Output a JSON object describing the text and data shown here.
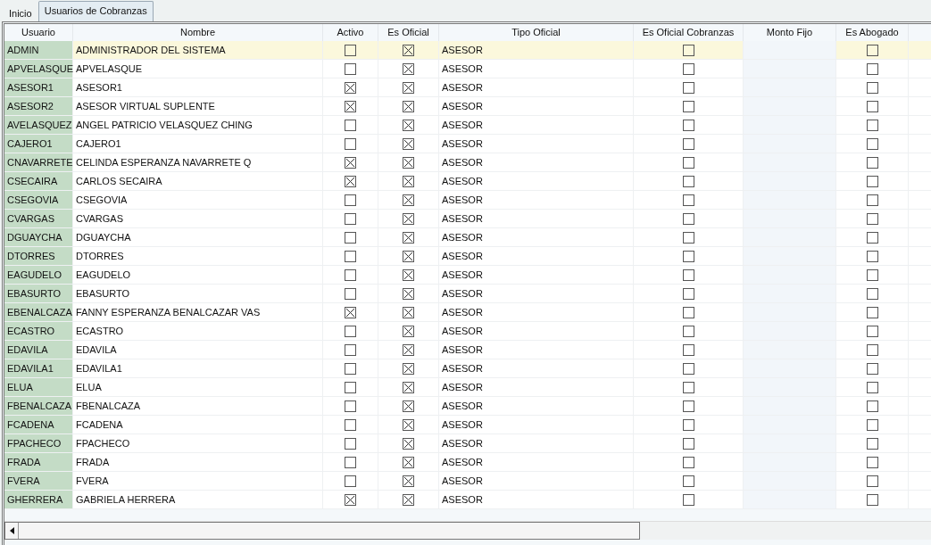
{
  "tabs": [
    {
      "label": "Inicio",
      "selected": false
    },
    {
      "label": "Usuarios de Cobranzas",
      "selected": true
    }
  ],
  "table": {
    "columns": [
      "Usuario",
      "Nombre",
      "Activo",
      "Es Oficial",
      "Tipo Oficial",
      "Es Oficial Cobranzas",
      "Monto Fijo",
      "Es Abogado"
    ],
    "rows": [
      {
        "usuario": "ADMIN",
        "nombre": "ADMINISTRADOR DEL SISTEMA",
        "activo": false,
        "es_oficial": true,
        "tipo_oficial": "ASESOR",
        "es_oficial_cobranzas": false,
        "es_abogado": false,
        "selected": true
      },
      {
        "usuario": "APVELASQUE",
        "nombre": "APVELASQUE",
        "activo": false,
        "es_oficial": true,
        "tipo_oficial": "ASESOR",
        "es_oficial_cobranzas": false,
        "es_abogado": false,
        "selected": false
      },
      {
        "usuario": "ASESOR1",
        "nombre": "ASESOR1",
        "activo": true,
        "es_oficial": true,
        "tipo_oficial": "ASESOR",
        "es_oficial_cobranzas": false,
        "es_abogado": false,
        "selected": false
      },
      {
        "usuario": "ASESOR2",
        "nombre": "ASESOR VIRTUAL SUPLENTE",
        "activo": true,
        "es_oficial": true,
        "tipo_oficial": "ASESOR",
        "es_oficial_cobranzas": false,
        "es_abogado": false,
        "selected": false
      },
      {
        "usuario": "AVELASQUEZ",
        "nombre": "ANGEL PATRICIO VELASQUEZ CHING",
        "activo": false,
        "es_oficial": true,
        "tipo_oficial": "ASESOR",
        "es_oficial_cobranzas": false,
        "es_abogado": false,
        "selected": false
      },
      {
        "usuario": "CAJERO1",
        "nombre": "CAJERO1",
        "activo": false,
        "es_oficial": true,
        "tipo_oficial": "ASESOR",
        "es_oficial_cobranzas": false,
        "es_abogado": false,
        "selected": false
      },
      {
        "usuario": "CNAVARRETE",
        "nombre": "CELINDA ESPERANZA NAVARRETE Q",
        "activo": true,
        "es_oficial": true,
        "tipo_oficial": "ASESOR",
        "es_oficial_cobranzas": false,
        "es_abogado": false,
        "selected": false
      },
      {
        "usuario": "CSECAIRA",
        "nombre": "CARLOS SECAIRA",
        "activo": true,
        "es_oficial": true,
        "tipo_oficial": "ASESOR",
        "es_oficial_cobranzas": false,
        "es_abogado": false,
        "selected": false
      },
      {
        "usuario": "CSEGOVIA",
        "nombre": "CSEGOVIA",
        "activo": false,
        "es_oficial": true,
        "tipo_oficial": "ASESOR",
        "es_oficial_cobranzas": false,
        "es_abogado": false,
        "selected": false
      },
      {
        "usuario": "CVARGAS",
        "nombre": "CVARGAS",
        "activo": false,
        "es_oficial": true,
        "tipo_oficial": "ASESOR",
        "es_oficial_cobranzas": false,
        "es_abogado": false,
        "selected": false
      },
      {
        "usuario": "DGUAYCHA",
        "nombre": "DGUAYCHA",
        "activo": false,
        "es_oficial": true,
        "tipo_oficial": "ASESOR",
        "es_oficial_cobranzas": false,
        "es_abogado": false,
        "selected": false
      },
      {
        "usuario": "DTORRES",
        "nombre": "DTORRES",
        "activo": false,
        "es_oficial": true,
        "tipo_oficial": "ASESOR",
        "es_oficial_cobranzas": false,
        "es_abogado": false,
        "selected": false
      },
      {
        "usuario": "EAGUDELO",
        "nombre": "EAGUDELO",
        "activo": false,
        "es_oficial": true,
        "tipo_oficial": "ASESOR",
        "es_oficial_cobranzas": false,
        "es_abogado": false,
        "selected": false
      },
      {
        "usuario": "EBASURTO",
        "nombre": "EBASURTO",
        "activo": false,
        "es_oficial": true,
        "tipo_oficial": "ASESOR",
        "es_oficial_cobranzas": false,
        "es_abogado": false,
        "selected": false
      },
      {
        "usuario": "EBENALCAZA",
        "nombre": "FANNY ESPERANZA BENALCAZAR VAS",
        "activo": true,
        "es_oficial": true,
        "tipo_oficial": "ASESOR",
        "es_oficial_cobranzas": false,
        "es_abogado": false,
        "selected": false
      },
      {
        "usuario": "ECASTRO",
        "nombre": "ECASTRO",
        "activo": false,
        "es_oficial": true,
        "tipo_oficial": "ASESOR",
        "es_oficial_cobranzas": false,
        "es_abogado": false,
        "selected": false
      },
      {
        "usuario": "EDAVILA",
        "nombre": "EDAVILA",
        "activo": false,
        "es_oficial": true,
        "tipo_oficial": "ASESOR",
        "es_oficial_cobranzas": false,
        "es_abogado": false,
        "selected": false
      },
      {
        "usuario": "EDAVILA1",
        "nombre": "EDAVILA1",
        "activo": false,
        "es_oficial": true,
        "tipo_oficial": "ASESOR",
        "es_oficial_cobranzas": false,
        "es_abogado": false,
        "selected": false
      },
      {
        "usuario": "ELUA",
        "nombre": "ELUA",
        "activo": false,
        "es_oficial": true,
        "tipo_oficial": "ASESOR",
        "es_oficial_cobranzas": false,
        "es_abogado": false,
        "selected": false
      },
      {
        "usuario": "FBENALCAZA",
        "nombre": "FBENALCAZA",
        "activo": false,
        "es_oficial": true,
        "tipo_oficial": "ASESOR",
        "es_oficial_cobranzas": false,
        "es_abogado": false,
        "selected": false
      },
      {
        "usuario": "FCADENA",
        "nombre": "FCADENA",
        "activo": false,
        "es_oficial": true,
        "tipo_oficial": "ASESOR",
        "es_oficial_cobranzas": false,
        "es_abogado": false,
        "selected": false
      },
      {
        "usuario": "FPACHECO",
        "nombre": "FPACHECO",
        "activo": false,
        "es_oficial": true,
        "tipo_oficial": "ASESOR",
        "es_oficial_cobranzas": false,
        "es_abogado": false,
        "selected": false
      },
      {
        "usuario": "FRADA",
        "nombre": "FRADA",
        "activo": false,
        "es_oficial": true,
        "tipo_oficial": "ASESOR",
        "es_oficial_cobranzas": false,
        "es_abogado": false,
        "selected": false
      },
      {
        "usuario": "FVERA",
        "nombre": "FVERA",
        "activo": false,
        "es_oficial": true,
        "tipo_oficial": "ASESOR",
        "es_oficial_cobranzas": false,
        "es_abogado": false,
        "selected": false
      },
      {
        "usuario": "GHERRERA",
        "nombre": "GABRIELA HERRERA",
        "activo": true,
        "es_oficial": true,
        "tipo_oficial": "ASESOR",
        "es_oficial_cobranzas": false,
        "es_abogado": false,
        "selected": false
      }
    ]
  }
}
